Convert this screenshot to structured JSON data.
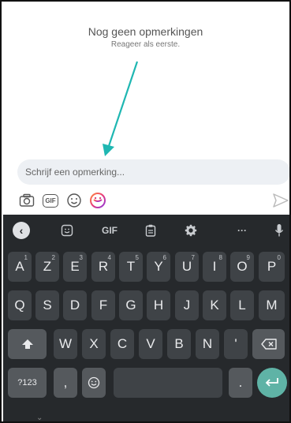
{
  "empty_state": {
    "title": "Nog geen opmerkingen",
    "subtitle": "Reageer als eerste."
  },
  "composer": {
    "placeholder": "Schrijf een opmerking...",
    "tools": [
      {
        "icon": "camera-icon"
      },
      {
        "icon": "gif-icon",
        "label": "GIF"
      },
      {
        "icon": "emoji-icon"
      },
      {
        "icon": "sticker-icon"
      }
    ],
    "send_icon": "send-icon"
  },
  "keyboard": {
    "toolbar": {
      "back_icon": "chevron-left-icon",
      "sticker_icon": "sticker-icon",
      "gif_label": "GIF",
      "clipboard_icon": "clipboard-icon",
      "settings_icon": "gear-icon",
      "more_label": "···",
      "mic_icon": "microphone-icon"
    },
    "row1": [
      {
        "label": "A",
        "hint": "1"
      },
      {
        "label": "Z",
        "hint": "2"
      },
      {
        "label": "E",
        "hint": "3"
      },
      {
        "label": "R",
        "hint": "4"
      },
      {
        "label": "T",
        "hint": "5"
      },
      {
        "label": "Y",
        "hint": "6"
      },
      {
        "label": "U",
        "hint": "7"
      },
      {
        "label": "I",
        "hint": "8"
      },
      {
        "label": "O",
        "hint": "9"
      },
      {
        "label": "P",
        "hint": "0"
      }
    ],
    "row2": [
      "Q",
      "S",
      "D",
      "F",
      "G",
      "H",
      "J",
      "K",
      "L",
      "M"
    ],
    "row3": [
      "W",
      "X",
      "C",
      "V",
      "B",
      "N",
      "'"
    ],
    "shift_icon": "shift-icon",
    "backspace_icon": "backspace-icon",
    "row4": {
      "symbols_label": "?123",
      "comma_label": ",",
      "emoji_icon": "emoji-icon",
      "period_label": ".",
      "enter_icon": "enter-icon"
    },
    "hide_icon": "chevron-down-icon"
  },
  "colors": {
    "arrow": "#1fb7b2",
    "keyboard_bg": "#26292c",
    "key_bg": "#3f4347",
    "enter_key": "#5fb3a6",
    "input_bg": "#edf0f4"
  }
}
